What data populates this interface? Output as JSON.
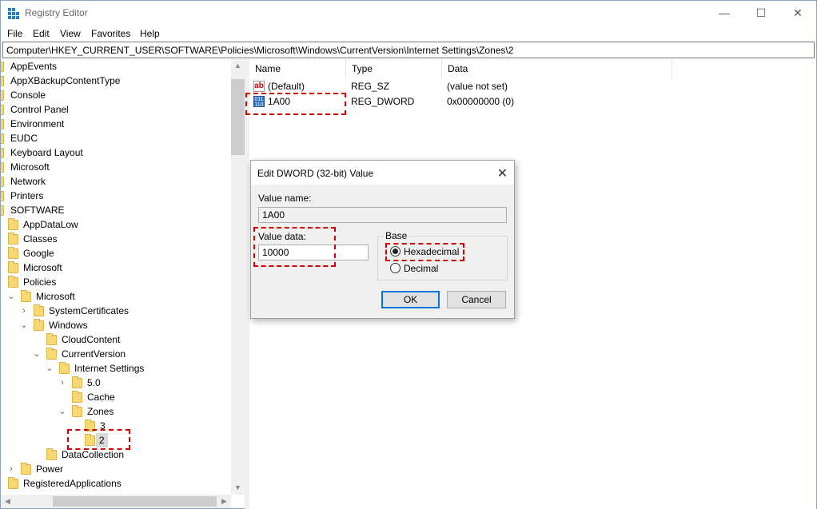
{
  "window": {
    "title": "Registry Editor",
    "minimize": "—",
    "maximize": "☐",
    "close": "✕"
  },
  "menu": [
    "File",
    "Edit",
    "View",
    "Favorites",
    "Help"
  ],
  "address": "Computer\\HKEY_CURRENT_USER\\SOFTWARE\\Policies\\Microsoft\\Windows\\CurrentVersion\\Internet Settings\\Zones\\2",
  "tree": [
    {
      "label": "AppEvents"
    },
    {
      "label": "AppXBackupContentType"
    },
    {
      "label": "Console"
    },
    {
      "label": "Control Panel"
    },
    {
      "label": "Environment"
    },
    {
      "label": "EUDC"
    },
    {
      "label": "Keyboard Layout"
    },
    {
      "label": "Microsoft"
    },
    {
      "label": "Network"
    },
    {
      "label": "Printers"
    },
    {
      "label": "SOFTWARE"
    },
    {
      "label": "AppDataLow"
    },
    {
      "label": "Classes"
    },
    {
      "label": "Google"
    },
    {
      "label": "Microsoft"
    },
    {
      "label": "Policies"
    },
    {
      "label": "Microsoft"
    },
    {
      "label": "SystemCertificates"
    },
    {
      "label": "Windows"
    },
    {
      "label": "CloudContent"
    },
    {
      "label": "CurrentVersion"
    },
    {
      "label": "Internet Settings"
    },
    {
      "label": "5.0"
    },
    {
      "label": "Cache"
    },
    {
      "label": "Zones"
    },
    {
      "label": "3"
    },
    {
      "label": "2"
    },
    {
      "label": "DataCollection"
    },
    {
      "label": "Power"
    },
    {
      "label": "RegisteredApplications"
    }
  ],
  "list": {
    "columns": [
      "Name",
      "Type",
      "Data"
    ],
    "rows": [
      {
        "name": "(Default)",
        "type": "REG_SZ",
        "data": "(value not set)",
        "icon": "string-value-icon"
      },
      {
        "name": "1A00",
        "type": "REG_DWORD",
        "data": "0x00000000 (0)",
        "icon": "binary-value-icon"
      }
    ]
  },
  "dialog": {
    "title": "Edit DWORD (32-bit) Value",
    "value_name_label": "Value name:",
    "value_name": "1A00",
    "value_data_label": "Value data:",
    "value_data": "10000",
    "base_label": "Base",
    "hex_label": "Hexadecimal",
    "dec_label": "Decimal",
    "base_selected": "Hexadecimal",
    "ok": "OK",
    "cancel": "Cancel"
  },
  "colors": {
    "highlight": "#d40000",
    "folder": "#f8d775",
    "accent": "#0078d7"
  }
}
